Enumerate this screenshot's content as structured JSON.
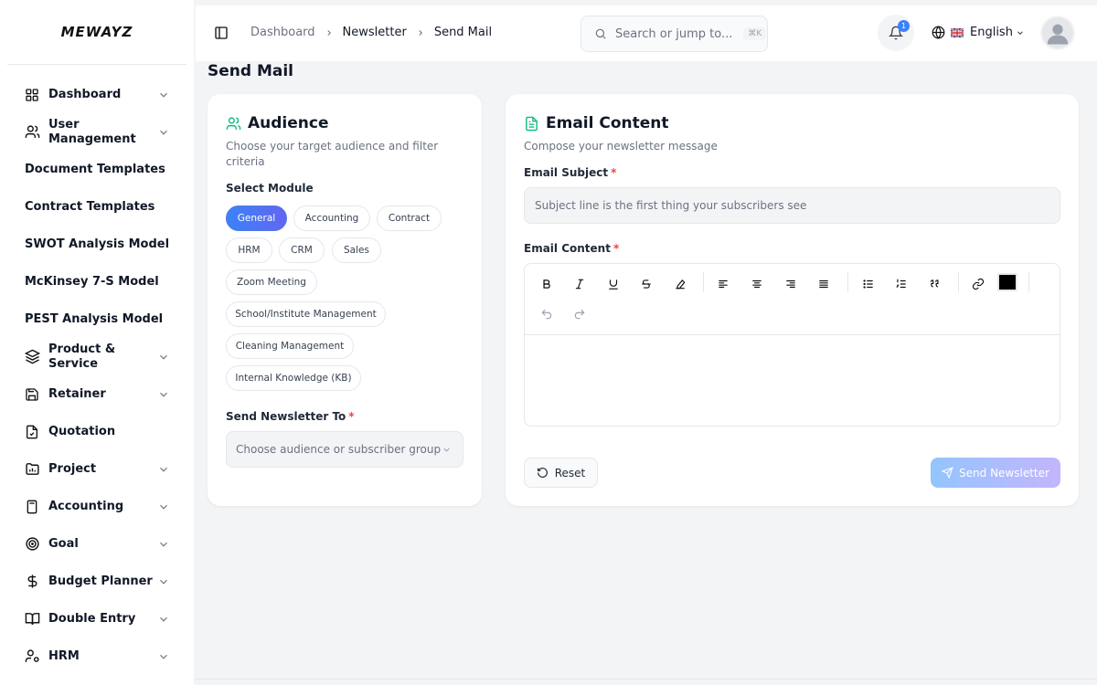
{
  "brand": {
    "logo_text": "MEWAYZ"
  },
  "sidebar": {
    "items": [
      {
        "label": "Dashboard",
        "icon": "grid-icon",
        "has_chevron": true
      },
      {
        "label": "User Management",
        "icon": "users-icon",
        "has_chevron": true
      },
      {
        "label": "Document Templates",
        "icon": "",
        "has_chevron": false
      },
      {
        "label": "Contract Templates",
        "icon": "",
        "has_chevron": false
      },
      {
        "label": "SWOT Analysis Model",
        "icon": "",
        "has_chevron": false
      },
      {
        "label": "McKinsey 7-S Model",
        "icon": "",
        "has_chevron": false
      },
      {
        "label": "PEST Analysis Model",
        "icon": "",
        "has_chevron": false
      },
      {
        "label": "Product & Service",
        "icon": "layers-icon",
        "has_chevron": true
      },
      {
        "label": "Retainer",
        "icon": "save-icon",
        "has_chevron": true
      },
      {
        "label": "Quotation",
        "icon": "file-check-icon",
        "has_chevron": false
      },
      {
        "label": "Project",
        "icon": "folder-chart-icon",
        "has_chevron": true
      },
      {
        "label": "Accounting",
        "icon": "calculator-icon",
        "has_chevron": true
      },
      {
        "label": "Goal",
        "icon": "target-icon",
        "has_chevron": true
      },
      {
        "label": "Budget Planner",
        "icon": "dollar-icon",
        "has_chevron": true
      },
      {
        "label": "Double Entry",
        "icon": "book-icon",
        "has_chevron": true
      },
      {
        "label": "HRM",
        "icon": "user-cog-icon",
        "has_chevron": true
      }
    ]
  },
  "topbar": {
    "breadcrumb": [
      "Dashboard",
      "Newsletter",
      "Send Mail"
    ],
    "search_placeholder": "Search or jump to...",
    "search_shortcut": "⌘K",
    "notification_count": "1",
    "language": "English"
  },
  "page": {
    "title": "Send Mail"
  },
  "audience": {
    "title": "Audience",
    "subtitle_line1": "Choose your target audience and filter",
    "subtitle_line2": "criteria",
    "select_module_label": "Select Module",
    "modules": [
      "General",
      "Accounting",
      "Contract",
      "HRM",
      "CRM",
      "Sales",
      "Zoom Meeting",
      "School/Institute Management",
      "Cleaning Management",
      "Internal Knowledge (KB)"
    ],
    "selected_module": "General",
    "send_to_label": "Send Newsletter To",
    "send_to_placeholder": "Choose audience or subscriber group"
  },
  "email": {
    "title": "Email Content",
    "subtitle": "Compose your newsletter message",
    "subject_label": "Email Subject",
    "subject_placeholder": "Subject line is the first thing your subscribers see",
    "content_label": "Email Content",
    "text_color": "#000000",
    "reset_label": "Reset",
    "send_label": "Send Newsletter"
  },
  "colors": {
    "accent": "#3b82f6",
    "required": "#ef4444",
    "icon_green": "#10b981"
  }
}
